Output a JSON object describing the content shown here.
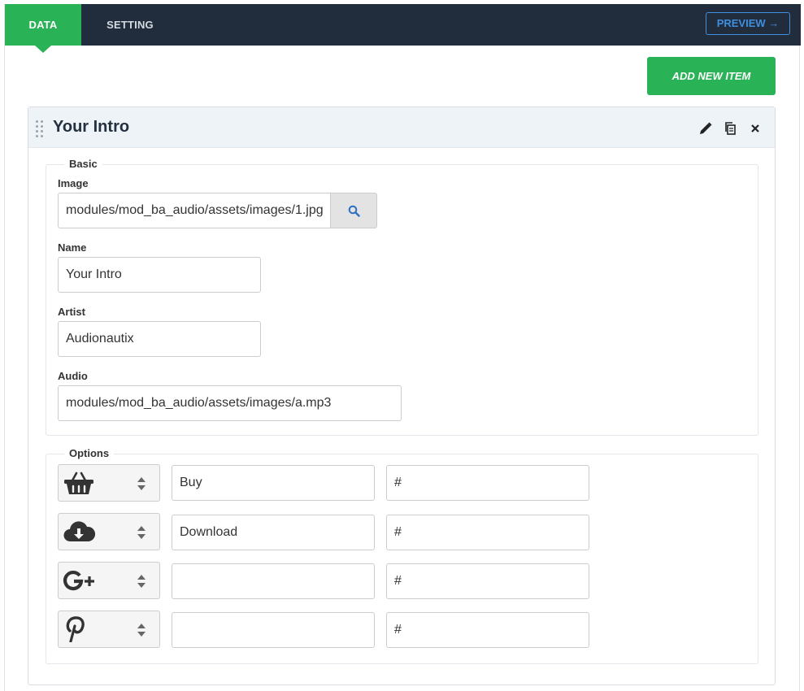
{
  "tabs": {
    "data": "DATA",
    "setting": "SETTING"
  },
  "preview_label": "PREVIEW →",
  "add_item_label": "ADD NEW ITEM",
  "item": {
    "title": "Your Intro",
    "icons": [
      "pencil-icon",
      "copy-icon",
      "close-icon"
    ]
  },
  "basic": {
    "legend": "Basic",
    "image_label": "Image",
    "image_value": "modules/mod_ba_audio/assets/images/1.jpg",
    "name_label": "Name",
    "name_value": "Your Intro",
    "artist_label": "Artist",
    "artist_value": "Audionautix",
    "audio_label": "Audio",
    "audio_value": "modules/mod_ba_audio/assets/images/a.mp3"
  },
  "options": {
    "legend": "Options",
    "rows": [
      {
        "icon": "basket-icon",
        "label": "Buy",
        "link": "#"
      },
      {
        "icon": "cloud-download-icon",
        "label": "Download",
        "link": "#"
      },
      {
        "icon": "google-plus-icon",
        "label": "",
        "link": "#"
      },
      {
        "icon": "pinterest-icon",
        "label": "",
        "link": "#"
      }
    ]
  },
  "colors": {
    "topbar": "#212d3d",
    "accent_green": "#2ab356",
    "accent_blue": "#3f8ee0"
  }
}
